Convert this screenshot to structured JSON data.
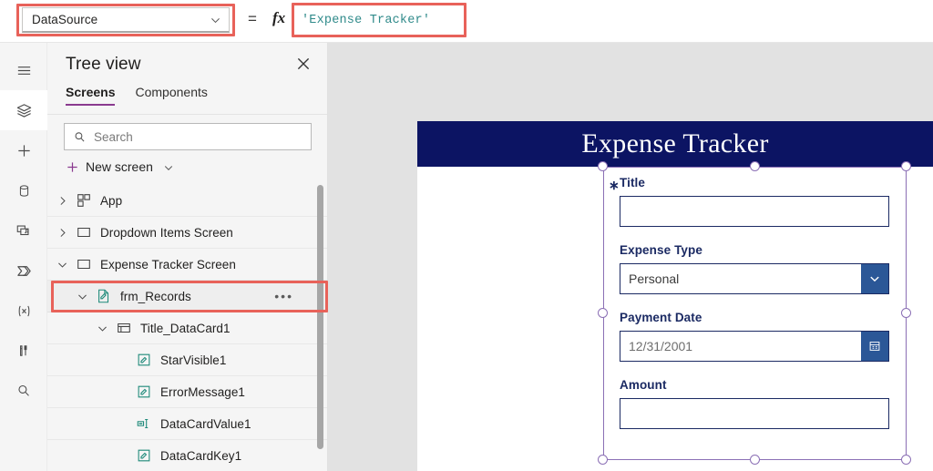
{
  "topbar": {
    "property_selector": {
      "value": "DataSource",
      "chevron_icon": "chevron-down-icon"
    },
    "equals_sign": "=",
    "fx_label": "fx",
    "formula": {
      "value": "'Expense Tracker'"
    }
  },
  "rail": {
    "items": [
      {
        "icon": "hamburger-menu-icon",
        "name": "menu"
      },
      {
        "icon": "layers-icon",
        "name": "tree-view",
        "active": true
      },
      {
        "icon": "plus-icon",
        "name": "insert"
      },
      {
        "icon": "database-icon",
        "name": "data"
      },
      {
        "icon": "media-icon",
        "name": "media"
      },
      {
        "icon": "power-automate-icon",
        "name": "power-automate"
      },
      {
        "icon": "variables-icon",
        "name": "variables",
        "label": "(x)"
      },
      {
        "icon": "tools-icon",
        "name": "tools"
      },
      {
        "icon": "search-icon",
        "name": "search"
      }
    ]
  },
  "treeview": {
    "title": "Tree view",
    "close_icon": "close-icon",
    "tabs": [
      {
        "label": "Screens",
        "active": true
      },
      {
        "label": "Components",
        "active": false
      }
    ],
    "search": {
      "placeholder": "Search",
      "icon": "search-icon"
    },
    "new_screen": {
      "label": "New screen",
      "plus_icon": "plus-icon",
      "chevron_icon": "chevron-down-icon"
    },
    "items": [
      {
        "label": "App",
        "icon": "app-icon",
        "indent": 0,
        "chevron": "right",
        "selected": false,
        "dots": false
      },
      {
        "label": "Dropdown Items Screen",
        "icon": "screen-icon",
        "indent": 0,
        "chevron": "right",
        "selected": false,
        "dots": false
      },
      {
        "label": "Expense Tracker Screen",
        "icon": "screen-icon",
        "indent": 0,
        "chevron": "down",
        "selected": false,
        "dots": false
      },
      {
        "label": "frm_Records",
        "icon": "form-icon",
        "indent": 1,
        "chevron": "down",
        "selected": true,
        "dots": true
      },
      {
        "label": "Title_DataCard1",
        "icon": "datacard-icon",
        "indent": 2,
        "chevron": "down",
        "selected": false,
        "dots": false
      },
      {
        "label": "StarVisible1",
        "icon": "label-icon",
        "indent": 3,
        "chevron": "none",
        "selected": false,
        "dots": false
      },
      {
        "label": "ErrorMessage1",
        "icon": "label-icon",
        "indent": 3,
        "chevron": "none",
        "selected": false,
        "dots": false
      },
      {
        "label": "DataCardValue1",
        "icon": "textinput-icon",
        "indent": 3,
        "chevron": "none",
        "selected": false,
        "dots": false
      },
      {
        "label": "DataCardKey1",
        "icon": "label-icon",
        "indent": 3,
        "chevron": "none",
        "selected": false,
        "dots": false
      }
    ]
  },
  "canvas": {
    "app_header_title": "Expense Tracker",
    "fields": [
      {
        "label": "Title",
        "required": true,
        "value": "",
        "control": "text"
      },
      {
        "label": "Expense Type",
        "required": false,
        "value": "Personal",
        "control": "dropdown"
      },
      {
        "label": "Payment Date",
        "required": false,
        "value": "12/31/2001",
        "placeholder_style": true,
        "control": "date"
      },
      {
        "label": "Amount",
        "required": false,
        "value": "",
        "control": "text"
      }
    ]
  },
  "highlights": {
    "accent_red": "#e8625a",
    "count": 3,
    "targets": [
      "property-selector",
      "formula-bar",
      "frm_Records-tree-row"
    ]
  },
  "colors": {
    "app_header_navy": "#0c1463",
    "form_border_navy": "#1b2a63",
    "control_button_blue": "#2b5797",
    "selection_purple": "#8b6fb5",
    "tab_underline_purple": "#8a3a8f",
    "formula_teal": "#2f8a8a"
  }
}
